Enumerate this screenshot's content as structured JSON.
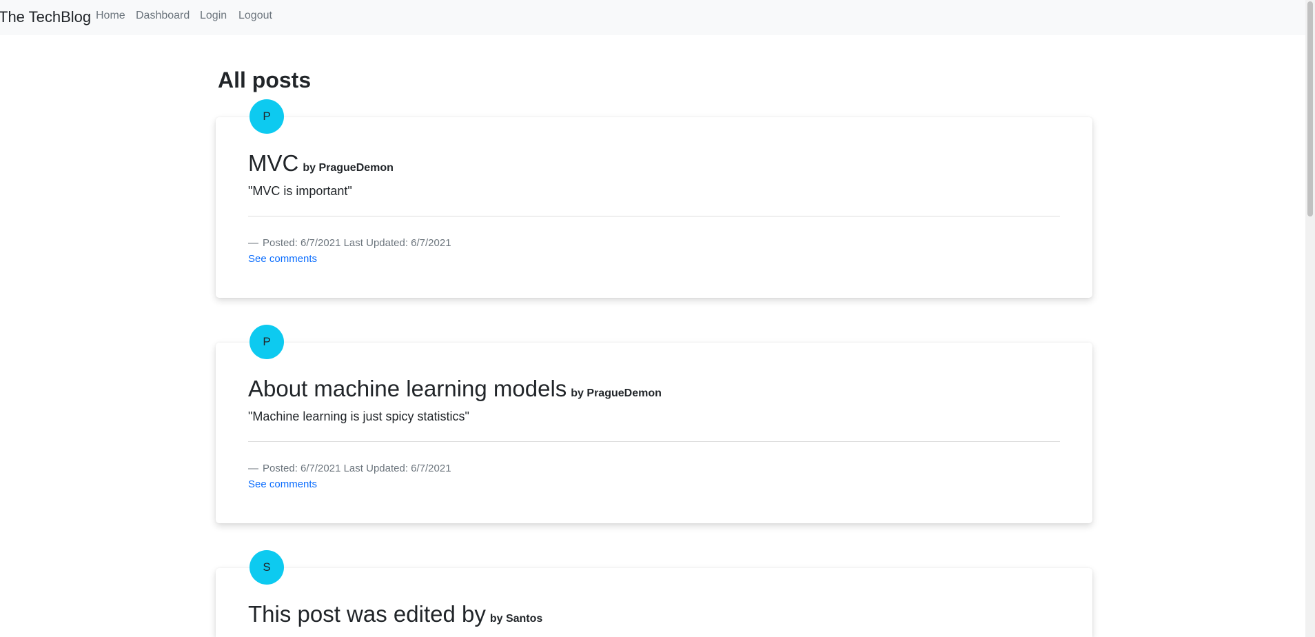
{
  "nav": {
    "brand": "The TechBlog",
    "links": [
      "Home",
      "Dashboard",
      "Login",
      "Logout"
    ]
  },
  "main": {
    "title": "All posts",
    "posts": [
      {
        "avatar": "P",
        "title": "MVC",
        "author": "by PragueDemon",
        "body": "\"MVC is important\"",
        "dash": "—",
        "meta": "Posted: 6/7/2021 Last Updated: 6/7/2021",
        "comments_label": "See comments"
      },
      {
        "avatar": "P",
        "title": "About machine learning models",
        "author": "by PragueDemon",
        "body": "\"Machine learning is just spicy statistics\"",
        "dash": "—",
        "meta": "Posted: 6/7/2021 Last Updated: 6/7/2021",
        "comments_label": "See comments"
      },
      {
        "avatar": "S",
        "title": "This post was edited by",
        "author": "by Santos"
      }
    ]
  },
  "colors": {
    "avatar_bg": "#0dcaf0",
    "link": "#0d6efd",
    "navbar_bg": "#f8f9fa"
  }
}
